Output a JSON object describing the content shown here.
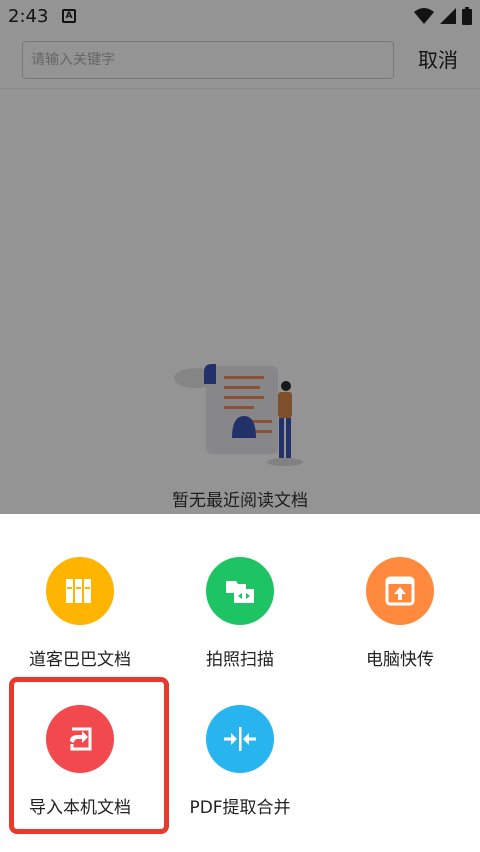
{
  "status": {
    "time": "2:43",
    "notification_icon": "a-icon"
  },
  "search": {
    "placeholder": "请输入关键字",
    "value": "",
    "cancel_label": "取消"
  },
  "empty_state": {
    "text": "暂无最近阅读文档"
  },
  "actions": [
    {
      "label": "道客巴巴文档",
      "icon": "books-icon",
      "color": "#ffb400"
    },
    {
      "label": "拍照扫描",
      "icon": "scan-icon",
      "color": "#1ec464"
    },
    {
      "label": "电脑快传",
      "icon": "upload-icon",
      "color": "#ff8a3d"
    },
    {
      "label": "导入本机文档",
      "icon": "import-icon",
      "color": "#f2494f"
    },
    {
      "label": "PDF提取合并",
      "icon": "merge-icon",
      "color": "#28b5ef"
    }
  ],
  "highlight_color": "#e8392c"
}
